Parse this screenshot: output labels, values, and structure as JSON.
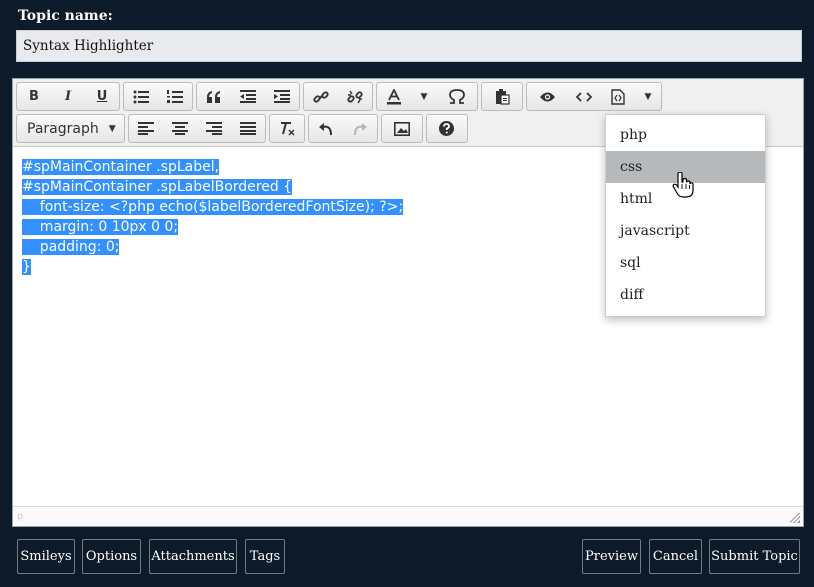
{
  "topic": {
    "label": "Topic name:",
    "value": "Syntax Highlighter"
  },
  "toolbar": {
    "bold": "B",
    "italic": "I",
    "underline": "U",
    "format_select": "Paragraph"
  },
  "content": {
    "lines": [
      "#spMainContainer .spLabel,",
      "#spMainContainer .spLabelBordered {",
      "    font-size: <?php echo($labelBorderedFontSize); ?>;",
      "    margin: 0 10px 0 0;",
      "    padding: 0;",
      "}"
    ]
  },
  "statusbar": {
    "path": "p"
  },
  "dropdown": {
    "items": [
      "php",
      "css",
      "html",
      "javascript",
      "sql",
      "diff"
    ],
    "hovered": "css"
  },
  "buttons": {
    "smileys": "Smileys",
    "options": "Options",
    "attachments": "Attachments",
    "tags": "Tags",
    "preview": "Preview",
    "cancel": "Cancel",
    "submit": "Submit Topic"
  },
  "colors": {
    "background": "#0d1a29",
    "selection": "#3390ff",
    "menu_hover": "#b6b9bc"
  }
}
